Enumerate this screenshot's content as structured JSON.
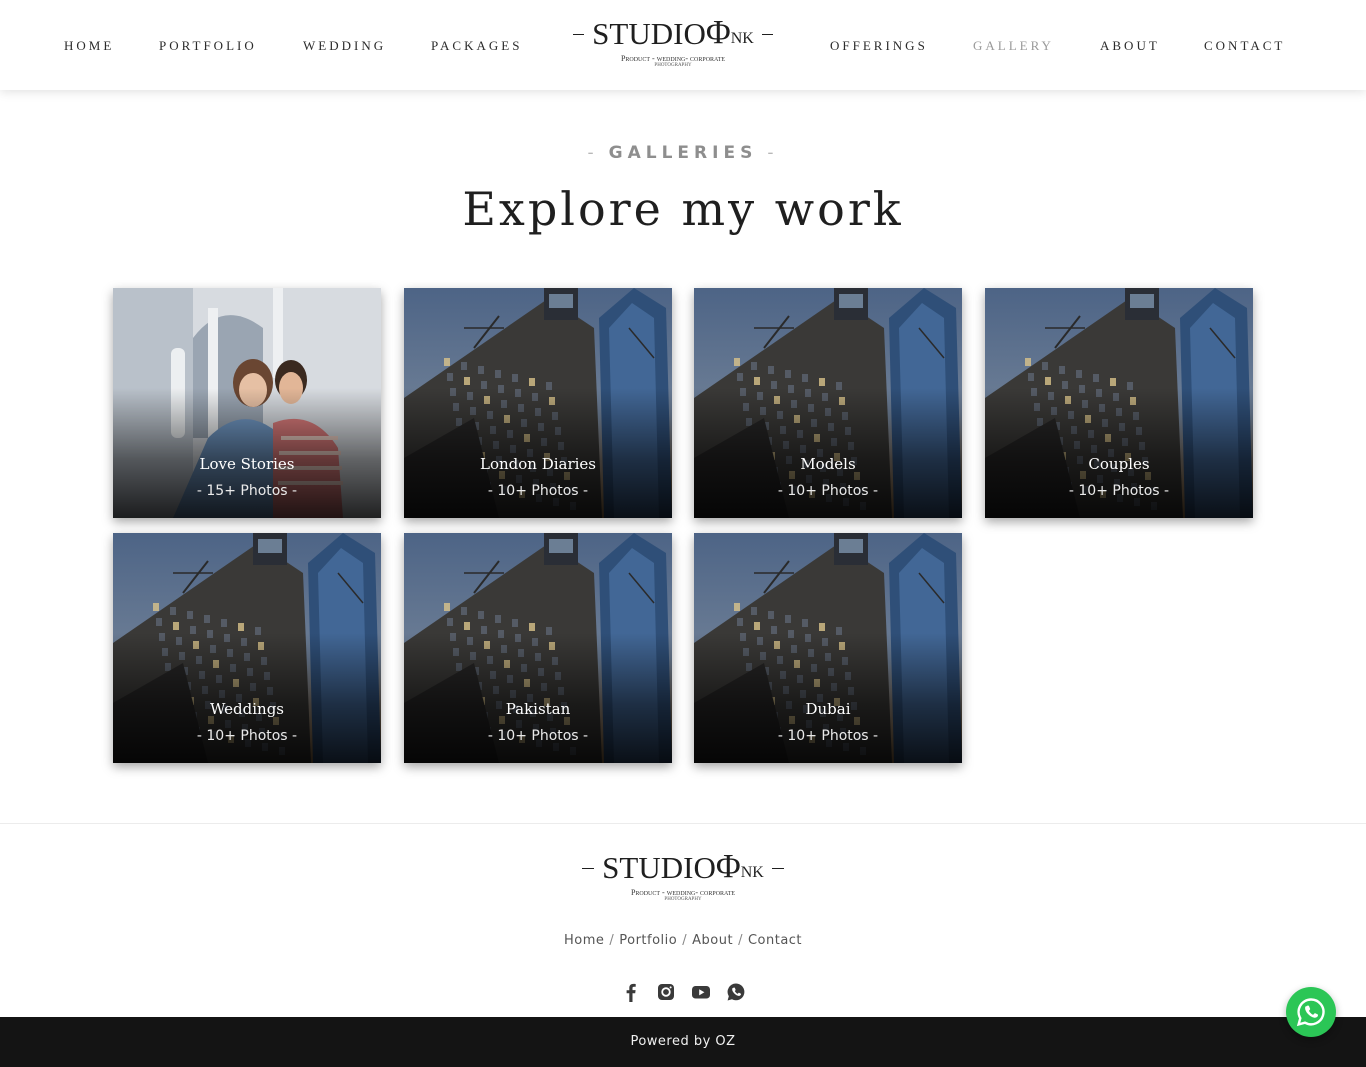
{
  "header": {
    "nav_left": [
      "HOME",
      "PORTFOLIO",
      "WEDDING",
      "PACKAGES"
    ],
    "nav_right": [
      "OFFERINGS",
      "GALLERY",
      "ABOUT",
      "CONTACT"
    ],
    "active_item": "GALLERY"
  },
  "logo": {
    "word_main": "STUDIO",
    "word_phi": "Φ",
    "word_ink": "NK",
    "tagline": "Product - wedding- corporate",
    "sub": "photography"
  },
  "section": {
    "eyebrow": "GALLERIES",
    "title": "Explore my work"
  },
  "galleries": [
    {
      "title": "Love Stories",
      "count": "- 15+ Photos -",
      "image": "couple-photo"
    },
    {
      "title": "London Diaries",
      "count": "- 10+ Photos -",
      "image": "building-photo"
    },
    {
      "title": "Models",
      "count": "- 10+ Photos -",
      "image": "building-photo"
    },
    {
      "title": "Couples",
      "count": "- 10+ Photos -",
      "image": "building-photo"
    },
    {
      "title": "Weddings",
      "count": "- 10+ Photos -",
      "image": "building-photo"
    },
    {
      "title": "Pakistan",
      "count": "- 10+ Photos -",
      "image": "building-photo"
    },
    {
      "title": "Dubai",
      "count": "- 10+ Photos -",
      "image": "building-photo"
    }
  ],
  "footer": {
    "links": [
      "Home",
      "Portfolio",
      "About",
      "Contact"
    ],
    "separator": "/",
    "social_icons": [
      "facebook-icon",
      "instagram-icon",
      "youtube-icon",
      "whatsapp-icon"
    ],
    "powered_by": "Powered by OZ"
  },
  "colors": {
    "nav_text": "#2b2b2b",
    "nav_active": "#9a9a9a",
    "footer_bar": "#141414",
    "whatsapp_green": "#2bc656"
  }
}
